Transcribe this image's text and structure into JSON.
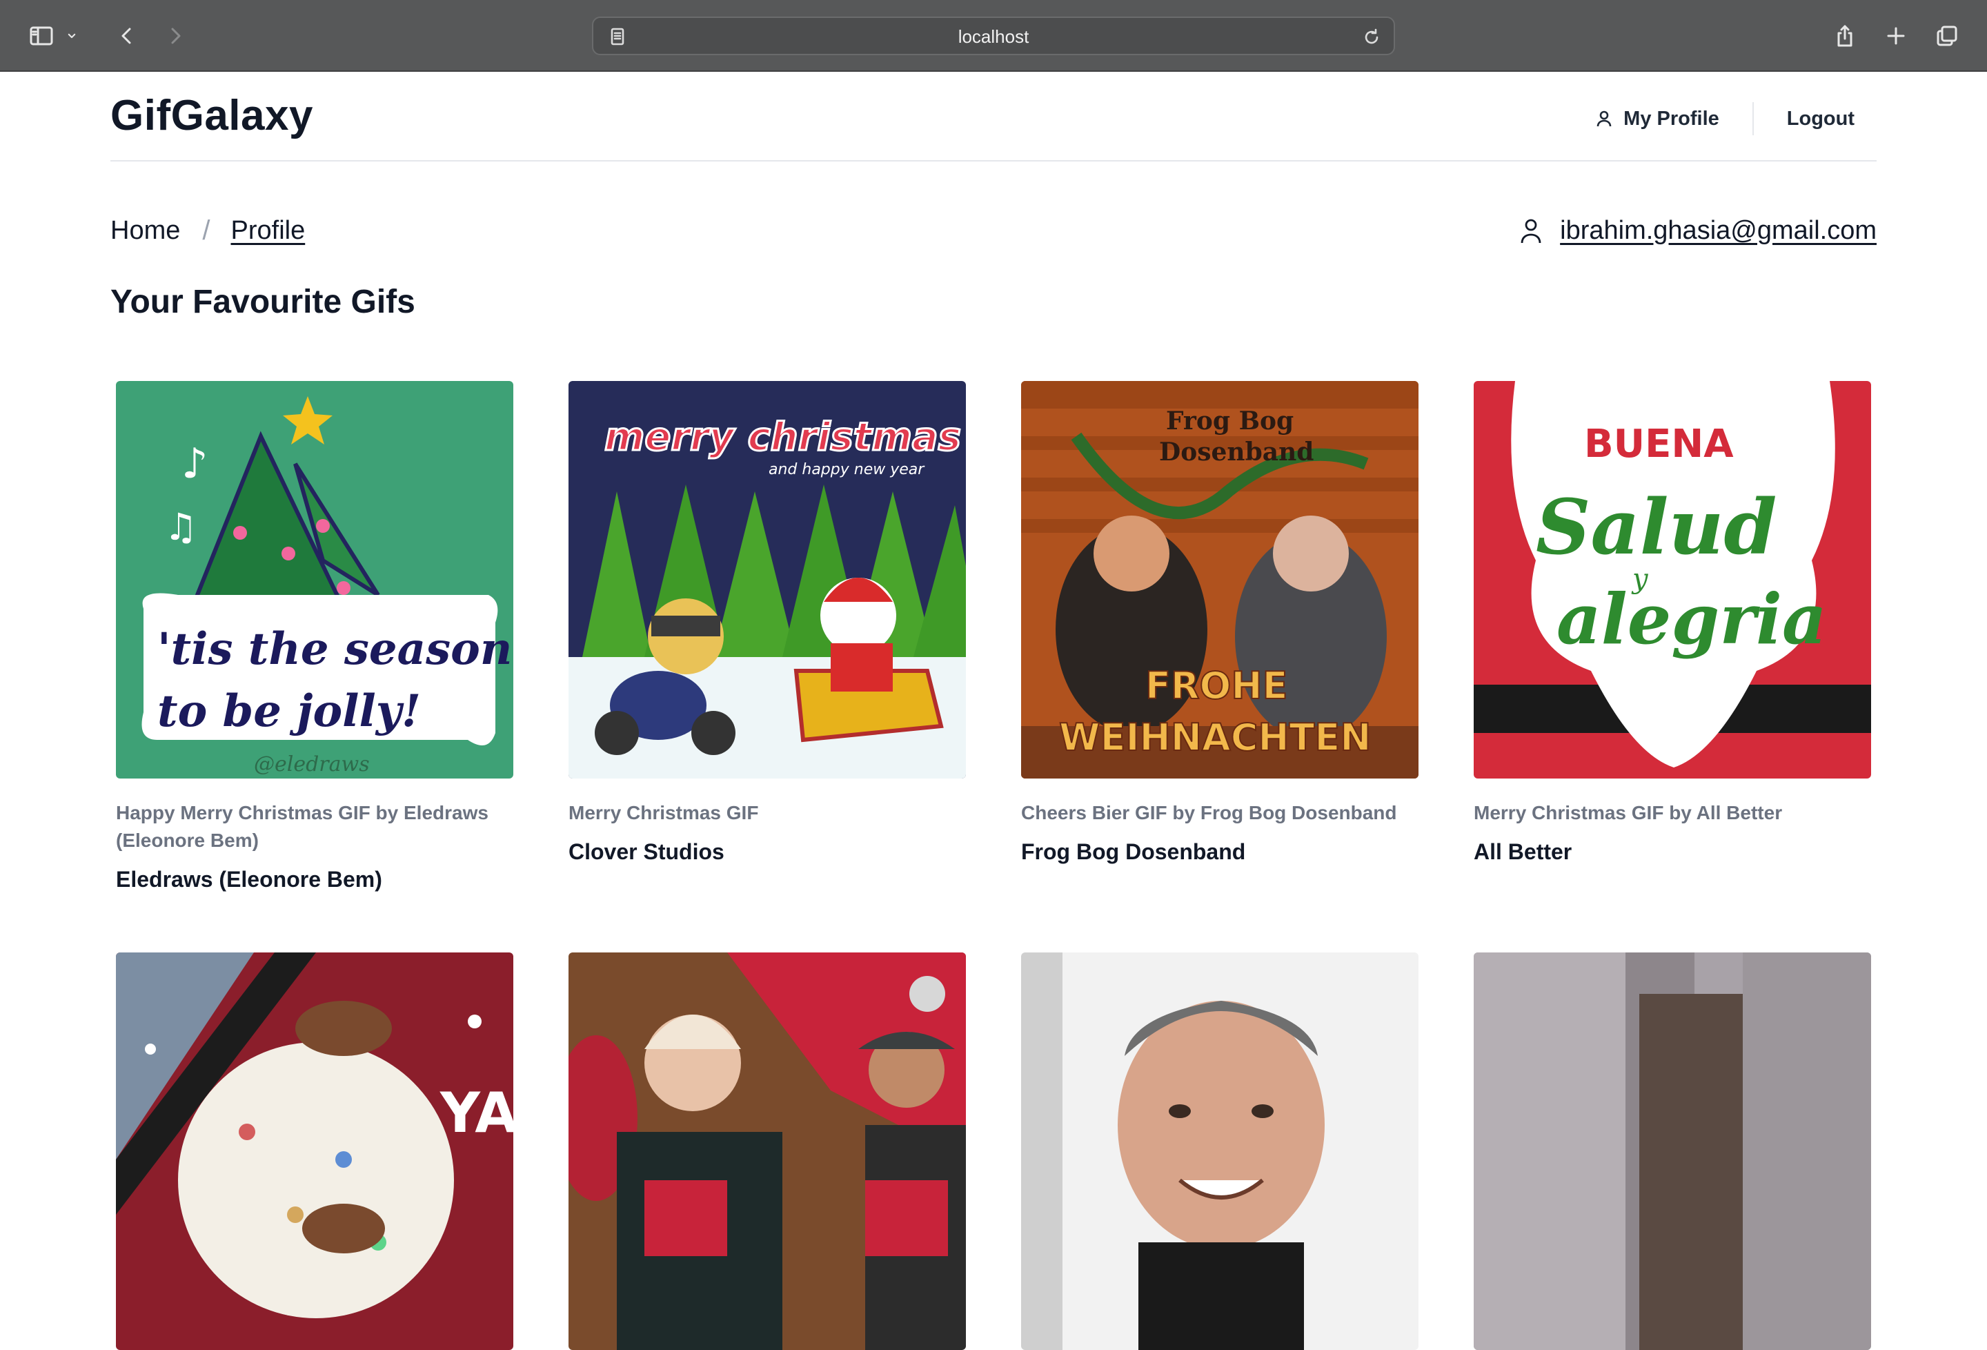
{
  "browser": {
    "url": "localhost"
  },
  "header": {
    "brand": "GifGalaxy",
    "my_profile_label": "My Profile",
    "logout_label": "Logout"
  },
  "breadcrumb": {
    "home": "Home",
    "separator": "/",
    "current": "Profile"
  },
  "user": {
    "email": "ibrahim.ghasia@gmail.com"
  },
  "section_title": "Your Favourite Gifs",
  "gifs": [
    {
      "title": "Happy Merry Christmas GIF by Eledraws (Eleonore Bem)",
      "author": "Eledraws (Eleonore Bem)",
      "overlay_text": "'tis the season to be jolly!",
      "watermark": "@eledraws"
    },
    {
      "title": "Merry Christmas GIF",
      "author": "Clover Studios",
      "overlay_text": "merry christmas",
      "overlay_subtext": "and happy new year"
    },
    {
      "title": "Cheers Bier GIF by Frog Bog Dosenband",
      "author": "Frog Bog Dosenband",
      "overlay_text": "FROHE WEIHNACHTEN",
      "overlay_top": "Frog Bog Dosenband"
    },
    {
      "title": "Merry Christmas GIF by All Better",
      "author": "All Better",
      "overlay_top": "BUENA",
      "overlay_text": "Salud y alegria"
    },
    {
      "title": "",
      "author": ""
    },
    {
      "title": "",
      "author": ""
    },
    {
      "title": "",
      "author": ""
    },
    {
      "title": "",
      "author": ""
    }
  ],
  "colors": {
    "chrome_bg": "#575859",
    "text_primary": "#111827",
    "text_muted": "#6b7280",
    "divider": "#e5e7eb"
  }
}
